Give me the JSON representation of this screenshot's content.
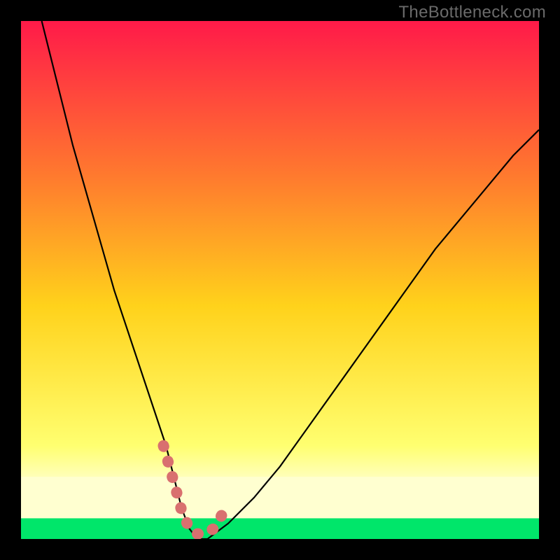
{
  "watermark": "TheBottleneck.com",
  "chart_data": {
    "type": "line",
    "title": "",
    "xlabel": "",
    "ylabel": "",
    "xlim": [
      0,
      100
    ],
    "ylim": [
      0,
      100
    ],
    "background_gradient": {
      "top": "#ff1a49",
      "mid_upper": "#ff7a2e",
      "mid": "#ffd21b",
      "mid_lower": "#ffff70",
      "band": "#ffffd0",
      "bottom": "#00e66a"
    },
    "series": [
      {
        "name": "curve",
        "stroke": "#000000",
        "stroke_width": 2.2,
        "x": [
          4,
          6,
          8,
          10,
          12,
          14,
          16,
          18,
          20,
          22,
          24,
          26,
          28,
          29.5,
          31,
          32.5,
          34,
          36,
          40,
          45,
          50,
          55,
          60,
          65,
          70,
          75,
          80,
          85,
          90,
          95,
          100
        ],
        "y": [
          100,
          92,
          84,
          76,
          69,
          62,
          55,
          48,
          42,
          36,
          30,
          24,
          18,
          12,
          6,
          2,
          0,
          0,
          3,
          8,
          14,
          21,
          28,
          35,
          42,
          49,
          56,
          62,
          68,
          74,
          79
        ]
      },
      {
        "name": "minimum-overlay",
        "stroke": "#d9706f",
        "stroke_width": 16,
        "linecap": "round",
        "dash": "1 22",
        "x": [
          27.5,
          29.5,
          31.0,
          32.5,
          34.0,
          35.5,
          37.2,
          39.0
        ],
        "y": [
          18.0,
          11.0,
          5.5,
          2.0,
          1.0,
          1.0,
          2.0,
          5.0
        ]
      }
    ],
    "bands": [
      {
        "y0": 0,
        "y1": 4,
        "color": "#00e66a"
      },
      {
        "y0": 4,
        "y1": 12,
        "color": "#ffffd0"
      }
    ]
  }
}
